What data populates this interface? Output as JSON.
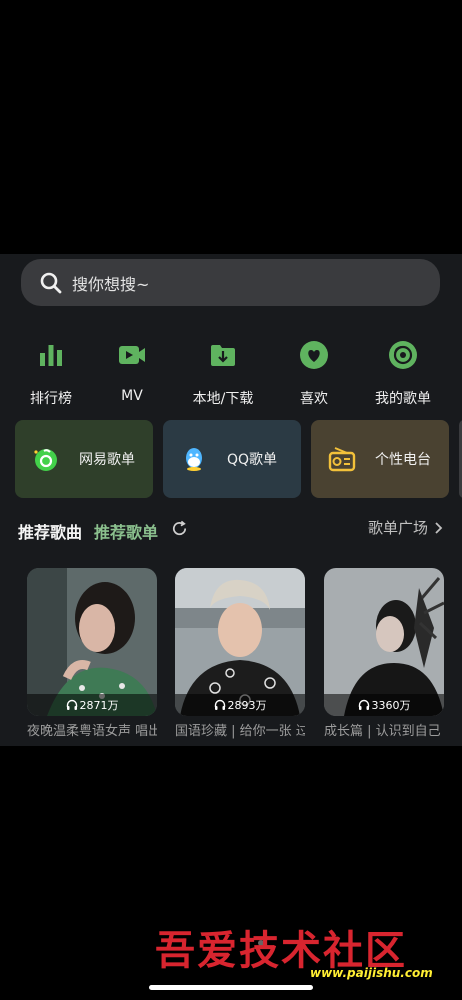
{
  "search": {
    "placeholder": "搜你想搜~"
  },
  "nav": [
    {
      "label": "排行榜",
      "icon": "bar-chart-icon"
    },
    {
      "label": "MV",
      "icon": "video-icon"
    },
    {
      "label": "本地/下载",
      "icon": "download-folder-icon"
    },
    {
      "label": "喜欢",
      "icon": "heart-icon"
    },
    {
      "label": "我的歌单",
      "icon": "disc-icon"
    }
  ],
  "cards": [
    {
      "label": "网易歌单",
      "icon": "netease-icon",
      "bg": "#2f3f2a"
    },
    {
      "label": "QQ歌单",
      "icon": "qq-icon",
      "bg": "#2b3a44"
    },
    {
      "label": "个性电台",
      "icon": "radio-icon",
      "bg": "#4a4231"
    }
  ],
  "section": {
    "tab_songs": "推荐歌曲",
    "tab_playlists": "推荐歌单",
    "more": "歌单广场"
  },
  "playlists": [
    {
      "plays": "2871万",
      "title": "夜晚温柔粤语女声 唱出港放下明心事"
    },
    {
      "plays": "2893万",
      "title": "国语珍藏 | 给你一张 过去的CD"
    },
    {
      "plays": "3360万",
      "title": "成长篇 | 认识到自己 的平凡，并且接受"
    }
  ],
  "watermark": {
    "text": "吾爱技术社区",
    "url": "www.paijishu.com"
  },
  "colors": {
    "accent": "#5fb35f",
    "background": "#181a1d"
  }
}
